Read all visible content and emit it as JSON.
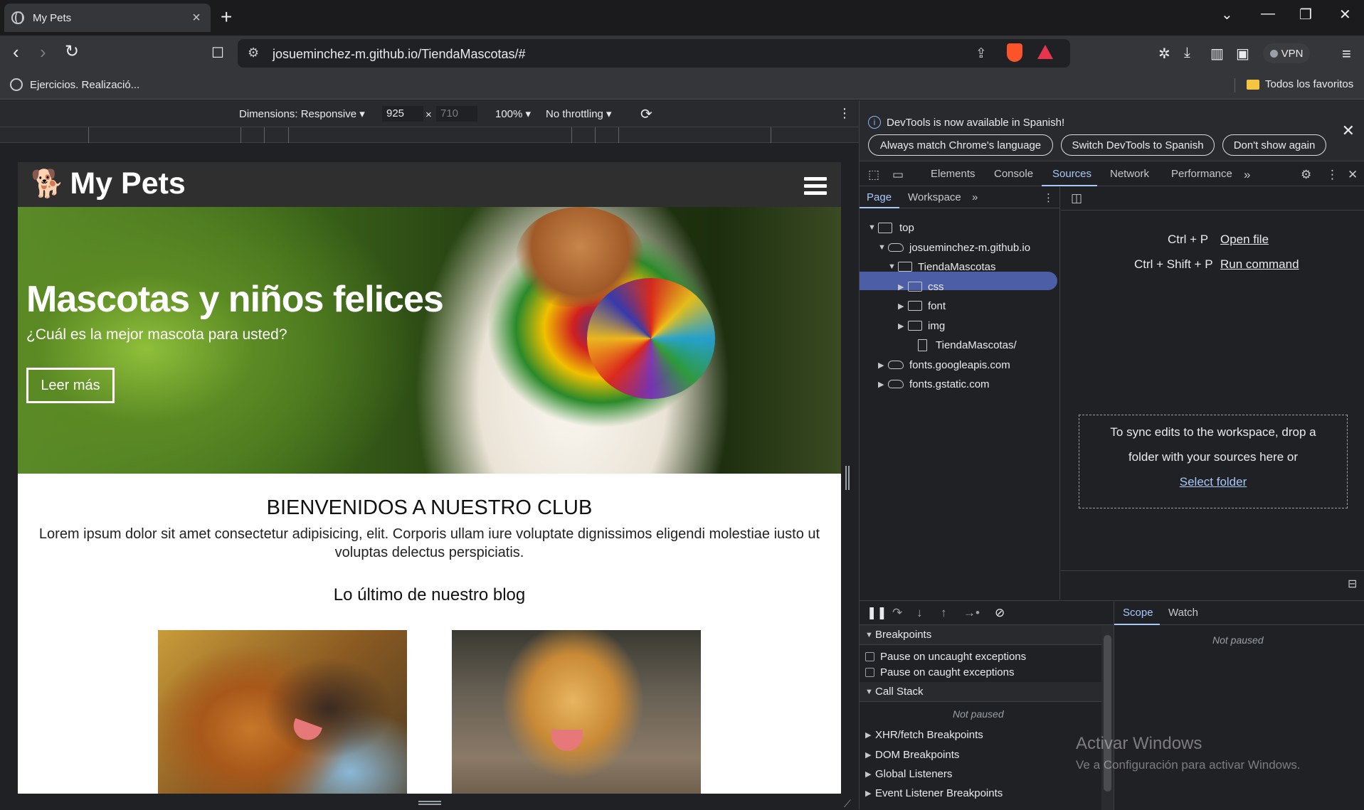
{
  "browser": {
    "tab_title": "My Pets",
    "new_tab": "+",
    "url": "josueminchez-m.github.io/TiendaMascotas/#",
    "vpn_label": "VPN",
    "bookmark_left": "Ejercicios. Realizació...",
    "bookmark_right": "Todos los favoritos"
  },
  "device_toolbar": {
    "dimensions": "Dimensions: Responsive ▾",
    "width": "925",
    "height": "710",
    "times": "×",
    "zoom": "100% ▾",
    "throttle": "No throttling ▾"
  },
  "site": {
    "logo": "My Pets",
    "hero_title": "Mascotas y niños felices",
    "hero_subtitle": "¿Cuál es la mejor mascota para usted?",
    "hero_button": "Leer más",
    "welcome": "BIENVENIDOS A NUESTRO CLUB",
    "lorem": "Lorem ipsum dolor sit amet consectetur adipisicing, elit. Corporis ullam iure voluptate dignissimos eligendi molestiae iusto ut voluptas delectus perspiciatis.",
    "blog_title": "Lo último de nuestro blog"
  },
  "devtools": {
    "info_message": "DevTools is now available in Spanish!",
    "btn_match": "Always match Chrome's language",
    "btn_switch": "Switch DevTools to Spanish",
    "btn_dont": "Don't show again",
    "tabs": [
      "Elements",
      "Console",
      "Sources",
      "Network",
      "Performance"
    ],
    "nav_tabs": [
      "Page",
      "Workspace"
    ],
    "tree": {
      "top": "top",
      "domain": "josueminchez-m.github.io",
      "folder": "TiendaMascotas",
      "css": "css",
      "font": "font",
      "img": "img",
      "file": "TiendaMascotas/",
      "gapis": "fonts.googleapis.com",
      "gstatic": "fonts.gstatic.com"
    },
    "editor": {
      "open_shortcut": "Ctrl + P",
      "open_file": "Open file",
      "run_shortcut": "Ctrl + Shift + P",
      "run_command": "Run command",
      "drop_text_1": "To sync edits to the workspace, drop a",
      "drop_text_2": "folder with your sources here or",
      "select_folder": "Select folder"
    },
    "debugger": {
      "breakpoints": "Breakpoints",
      "pause_uncaught": "Pause on uncaught exceptions",
      "pause_caught": "Pause on caught exceptions",
      "call_stack": "Call Stack",
      "not_paused": "Not paused",
      "xhr": "XHR/fetch Breakpoints",
      "dom": "DOM Breakpoints",
      "global": "Global Listeners",
      "event": "Event Listener Breakpoints",
      "scope": "Scope",
      "watch": "Watch",
      "scope_not_paused": "Not paused"
    }
  },
  "watermark": {
    "line1": "Activar Windows",
    "line2": "Ve a Configuración para activar Windows."
  }
}
